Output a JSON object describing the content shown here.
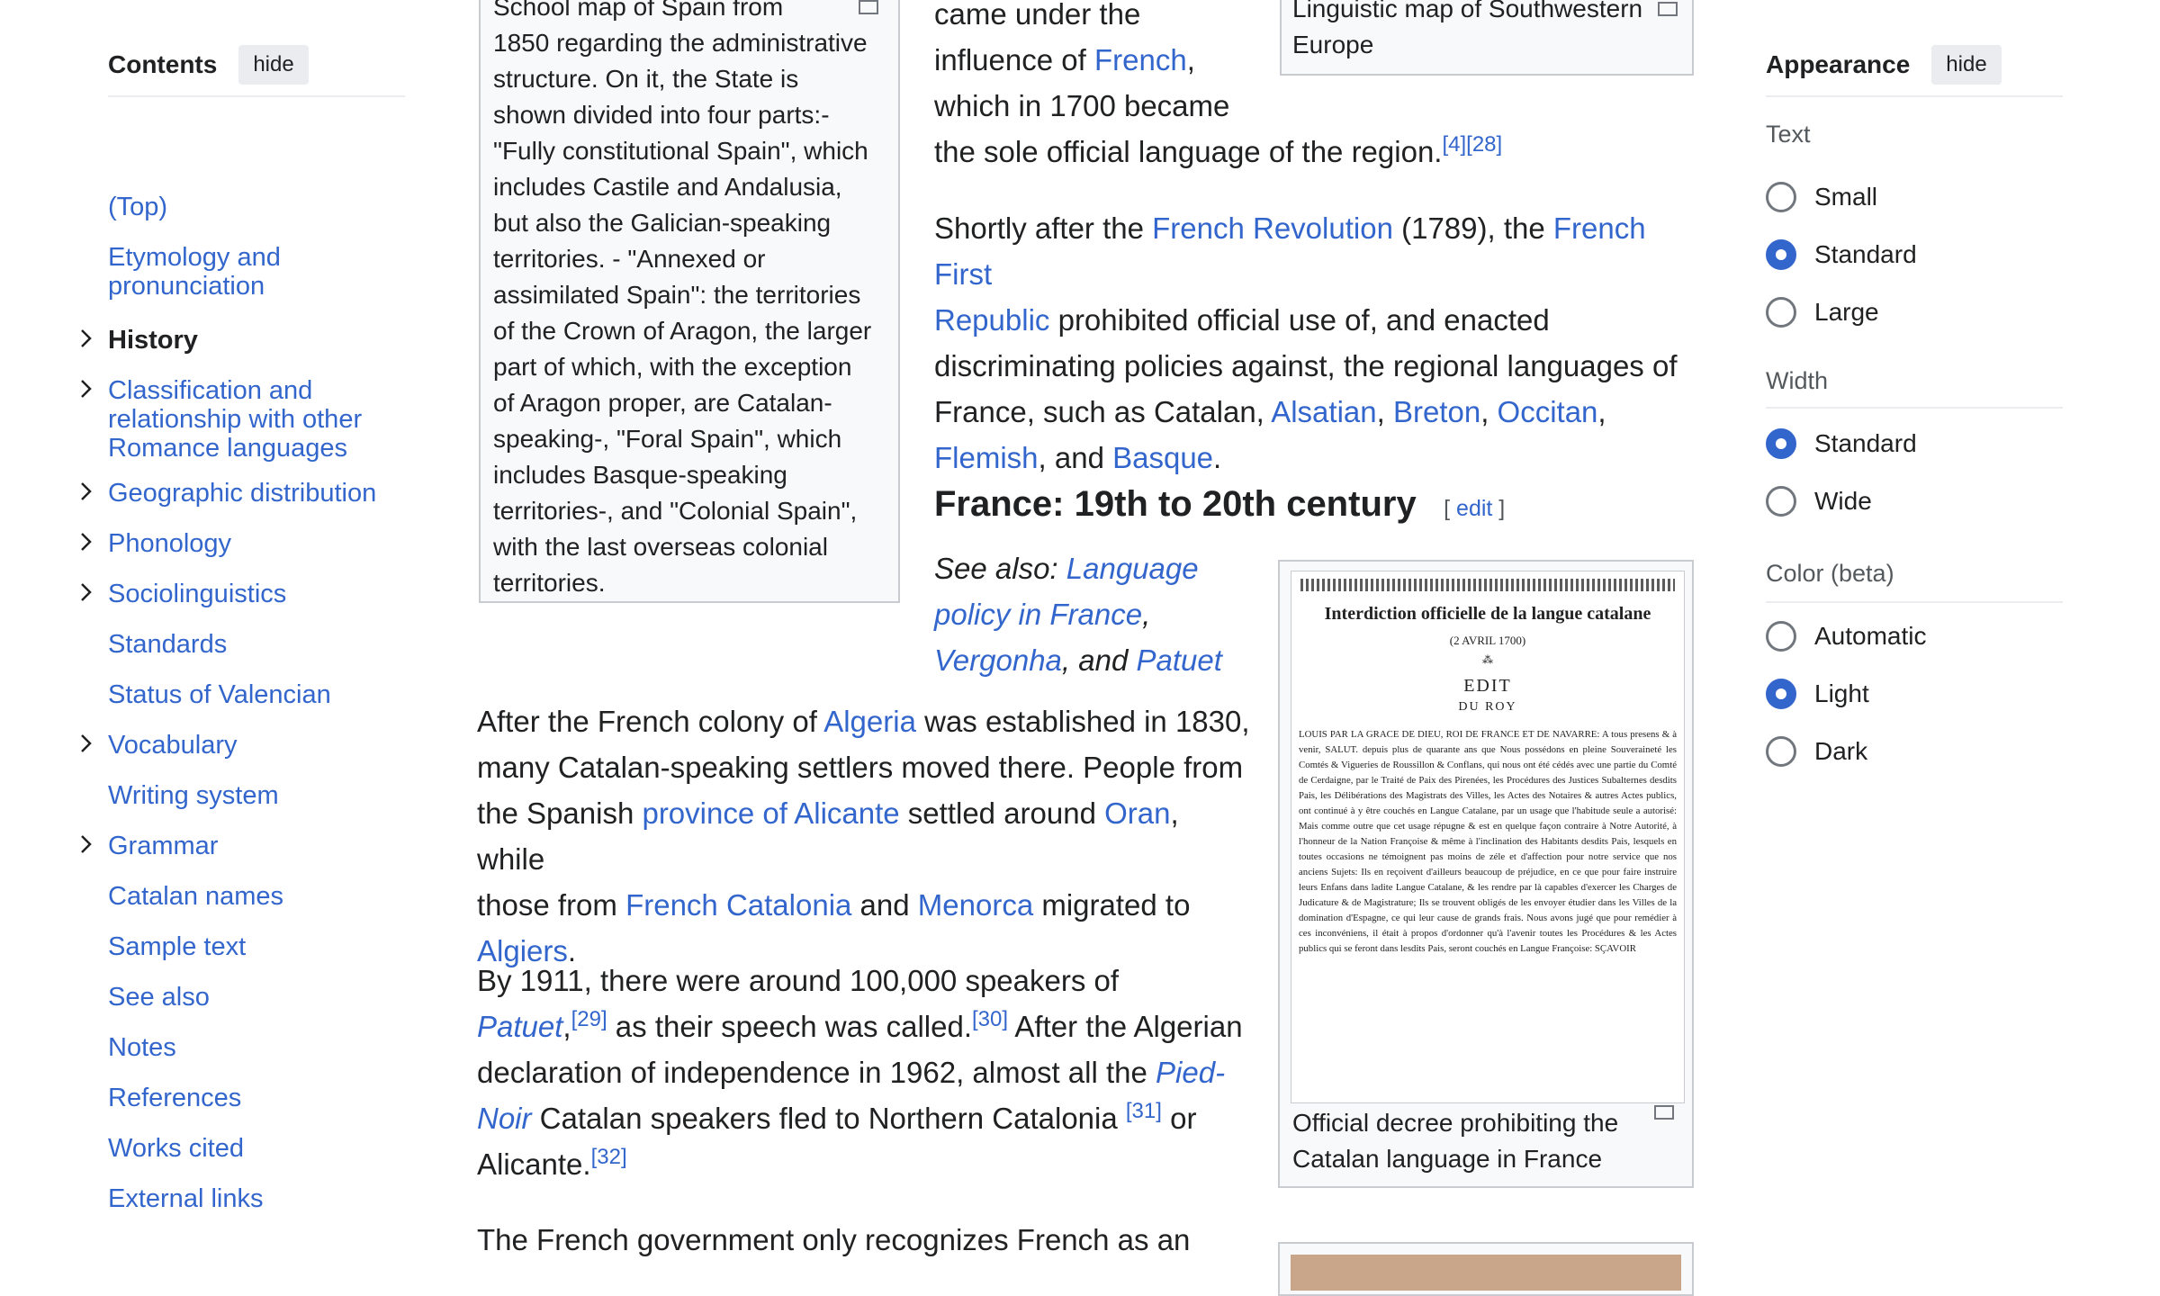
{
  "toc": {
    "title": "Contents",
    "hide_label": "hide",
    "items": [
      {
        "label": "(Top)",
        "expandable": false,
        "bold": false
      },
      {
        "label": "Etymology and pronunciation",
        "expandable": false,
        "bold": false
      },
      {
        "label": "History",
        "expandable": true,
        "bold": true
      },
      {
        "label": "Classification and relationship with other Romance languages",
        "expandable": true,
        "bold": false
      },
      {
        "label": "Geographic distribution",
        "expandable": true,
        "bold": false
      },
      {
        "label": "Phonology",
        "expandable": true,
        "bold": false
      },
      {
        "label": "Sociolinguistics",
        "expandable": true,
        "bold": false
      },
      {
        "label": "Standards",
        "expandable": false,
        "bold": false
      },
      {
        "label": "Status of Valencian",
        "expandable": false,
        "bold": false
      },
      {
        "label": "Vocabulary",
        "expandable": true,
        "bold": false
      },
      {
        "label": "Writing system",
        "expandable": false,
        "bold": false
      },
      {
        "label": "Grammar",
        "expandable": true,
        "bold": false
      },
      {
        "label": "Catalan names",
        "expandable": false,
        "bold": false
      },
      {
        "label": "Sample text",
        "expandable": false,
        "bold": false
      },
      {
        "label": "See also",
        "expandable": false,
        "bold": false
      },
      {
        "label": "Notes",
        "expandable": false,
        "bold": false
      },
      {
        "label": "References",
        "expandable": false,
        "bold": false
      },
      {
        "label": "Works cited",
        "expandable": false,
        "bold": false
      },
      {
        "label": "External links",
        "expandable": false,
        "bold": false
      }
    ]
  },
  "appearance": {
    "title": "Appearance",
    "hide_label": "hide",
    "text_label": "Text",
    "text_options": [
      "Small",
      "Standard",
      "Large"
    ],
    "text_selected": "Standard",
    "width_label": "Width",
    "width_options": [
      "Standard",
      "Wide"
    ],
    "width_selected": "Standard",
    "color_label": "Color (beta)",
    "color_options": [
      "Automatic",
      "Light",
      "Dark"
    ],
    "color_selected": "Light"
  },
  "map_caption": {
    "lines": [
      "School map of Spain from",
      "1850 regarding the administrative",
      "structure. On it, the State is",
      "shown divided into four parts:-",
      "\"Fully constitutional Spain\", which",
      "includes Castile and Andalusia,",
      "but also the Galician-speaking",
      "territories. - \"Annexed or",
      "assimilated Spain\": the territories",
      "of the Crown of Aragon, the larger",
      "part of which, with the exception",
      "of Aragon proper, are Catalan-",
      "speaking-, \"Foral Spain\", which",
      "includes Basque-speaking",
      "territories-, and \"Colonial Spain\",",
      "with the last overseas colonial",
      "territories."
    ]
  },
  "ling_caption": {
    "line1": "Linguistic map of Southwestern",
    "line2": "Europe"
  },
  "top_para": {
    "l1": "came under the",
    "l2_pre": "influence of ",
    "l2_link": "French",
    "l2_post": ",",
    "l3": "which in 1700 became",
    "l4": "the sole official language of the region.",
    "ref1": "[4]",
    "ref2": "[28]"
  },
  "revolution_para": {
    "t1": "Shortly after the ",
    "l_rev": "French Revolution",
    "t2": " (1789), the ",
    "l_rep1": "French First",
    "l_rep2": "Republic",
    "t3": " prohibited official use of, and enacted",
    "t4": "discriminating policies against, the regional languages of",
    "t5": "France, such as Catalan, ",
    "l_als": "Alsatian",
    "c1": ", ",
    "l_bre": "Breton",
    "c2": ", ",
    "l_occ": "Occitan",
    "c3": ",",
    "l_fle": "Flemish",
    "t6": ", and ",
    "l_bas": "Basque",
    "t7": "."
  },
  "section": {
    "heading": "France: 19th to 20th century",
    "edit_open": "[ ",
    "edit_label": "edit",
    "edit_close": " ]"
  },
  "see_also": {
    "prefix": "See also: ",
    "l1a": "Language",
    "l1b": "policy in France",
    "c1": ",",
    "l2": "Vergonha",
    "t2": ", and ",
    "l3": "Patuet"
  },
  "algeria_para": {
    "t1": "After the French colony of ",
    "l_alg": "Algeria",
    "t2": " was established in 1830,",
    "t3": "many Catalan-speaking settlers moved there. People from",
    "t4": "the Spanish ",
    "l_prov": "province of Alicante",
    "t5": " settled around ",
    "l_oran": "Oran",
    "t6": ", while",
    "t7": "those from ",
    "l_fcat": "French Catalonia",
    "t8": " and ",
    "l_men": "Menorca",
    "t9": " migrated to",
    "l_algiers": "Algiers",
    "t10": "."
  },
  "speakers_para": {
    "t1": "By 1911, there were around 100,000 speakers of",
    "l_pat": "Patuet",
    "c1": ",",
    "r29": "[29]",
    "t2": " as their speech was called.",
    "r30": "[30]",
    "t3": " After the Algerian",
    "t4": "declaration of independence in 1962, almost all the ",
    "l_pied": "Pied-",
    "l_noir": "Noir",
    "t5": " Catalan speakers fled to Northern Catalonia ",
    "r31": "[31]",
    "t6": " or",
    "t7": "Alicante.",
    "r32": "[32]"
  },
  "last_para": {
    "t1": "The French government only recognizes French as an"
  },
  "decree": {
    "title": "Interdiction officielle de la langue catalane",
    "date": "(2 AVRIL 1700)",
    "edit": "EDIT",
    "roy": "DU ROY",
    "body_start": "LOUIS PAR LA GRACE DE DIEU, ROI DE FRANCE ET DE NAVARRE: A tous presens & à venir, SALUT. depuis plus de quarante ans que Nous possédons en pleine Souveraineté les Comtés & Vigueries de Roussillon & Conflans, qui nous ont été cédés avec une partie du Comté de Cerdaigne, par le Traité de Paix des Pirenées, les Procédures des Justices Subalternes desdits Pais, les Délibérations des Magistrats des Villes, les Actes des Notaires & autres Actes publics, ont continué à y être couchés en Langue Catalane, par un usage que l'habitude seule a autorisé: Mais comme outre que cet usage répugne & est en quelque façon contraire à Notre Autorité, à l'honneur de la Nation Françoise & même à l'inclination des Habitants desdits Pais, lesquels en toutes occasions ne témoignent pas moins de zéle et d'affection pour notre service que nos anciens Sujets: Ils en reçoivent d'ailleurs beaucoup de préjudice, en ce que pour faire instruire leurs Enfans dans ladite Langue Catalane, & les rendre par là capables d'exercer les Charges de Judicature & de Magistrature; Ils se trouvent obligés de les envoyer étudier dans les Villes de la domination d'Espagne, ce qui leur cause de grands frais. Nous avons jugé que pour remédier à ces inconvéniens, il était à propos d'ordonner qu'à l'avenir toutes les Procédures & les Actes publics qui se feront dans lesdits Pais, seront couchés en Langue Françoise: SÇAVOIR",
    "caption1": "Official decree prohibiting the",
    "caption2": "Catalan language in France"
  }
}
